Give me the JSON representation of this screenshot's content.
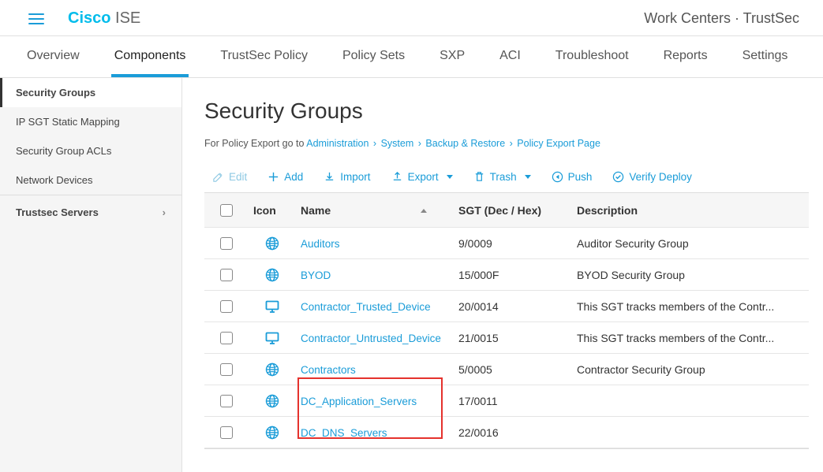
{
  "brand": {
    "cisco": "Cisco",
    "ise": "ISE"
  },
  "breadcrumb": "Work Centers · TrustSec",
  "tabs": [
    {
      "label": "Overview"
    },
    {
      "label": "Components"
    },
    {
      "label": "TrustSec Policy"
    },
    {
      "label": "Policy Sets"
    },
    {
      "label": "SXP"
    },
    {
      "label": "ACI"
    },
    {
      "label": "Troubleshoot"
    },
    {
      "label": "Reports"
    },
    {
      "label": "Settings"
    }
  ],
  "sidebar": {
    "items": [
      {
        "label": "Security Groups"
      },
      {
        "label": "IP SGT Static Mapping"
      },
      {
        "label": "Security Group ACLs"
      },
      {
        "label": "Network Devices"
      }
    ],
    "group": "Trustsec Servers"
  },
  "page": {
    "title": "Security Groups",
    "hint_prefix": "For Policy Export go to ",
    "hint_links": [
      "Administration",
      "System",
      "Backup & Restore",
      "Policy Export Page"
    ]
  },
  "toolbar": {
    "edit": "Edit",
    "add": "Add",
    "import": "Import",
    "export": "Export",
    "trash": "Trash",
    "push": "Push",
    "verify": "Verify Deploy"
  },
  "table": {
    "headers": {
      "icon": "Icon",
      "name": "Name",
      "sgt": "SGT (Dec / Hex)",
      "desc": "Description"
    },
    "rows": [
      {
        "icon": "globe",
        "name": "Auditors",
        "sgt": "9/0009",
        "desc": "Auditor Security Group"
      },
      {
        "icon": "globe",
        "name": "BYOD",
        "sgt": "15/000F",
        "desc": "BYOD Security Group"
      },
      {
        "icon": "monitor",
        "name": "Contractor_Trusted_Device",
        "sgt": "20/0014",
        "desc": "This SGT tracks members of the Contr..."
      },
      {
        "icon": "monitor",
        "name": "Contractor_Untrusted_Device",
        "sgt": "21/0015",
        "desc": "This SGT tracks members of the Contr..."
      },
      {
        "icon": "globe",
        "name": "Contractors",
        "sgt": "5/0005",
        "desc": "Contractor Security Group"
      },
      {
        "icon": "globe",
        "name": "DC_Application_Servers",
        "sgt": "17/0011",
        "desc": ""
      },
      {
        "icon": "globe",
        "name": "DC_DNS_Servers",
        "sgt": "22/0016",
        "desc": ""
      }
    ]
  }
}
